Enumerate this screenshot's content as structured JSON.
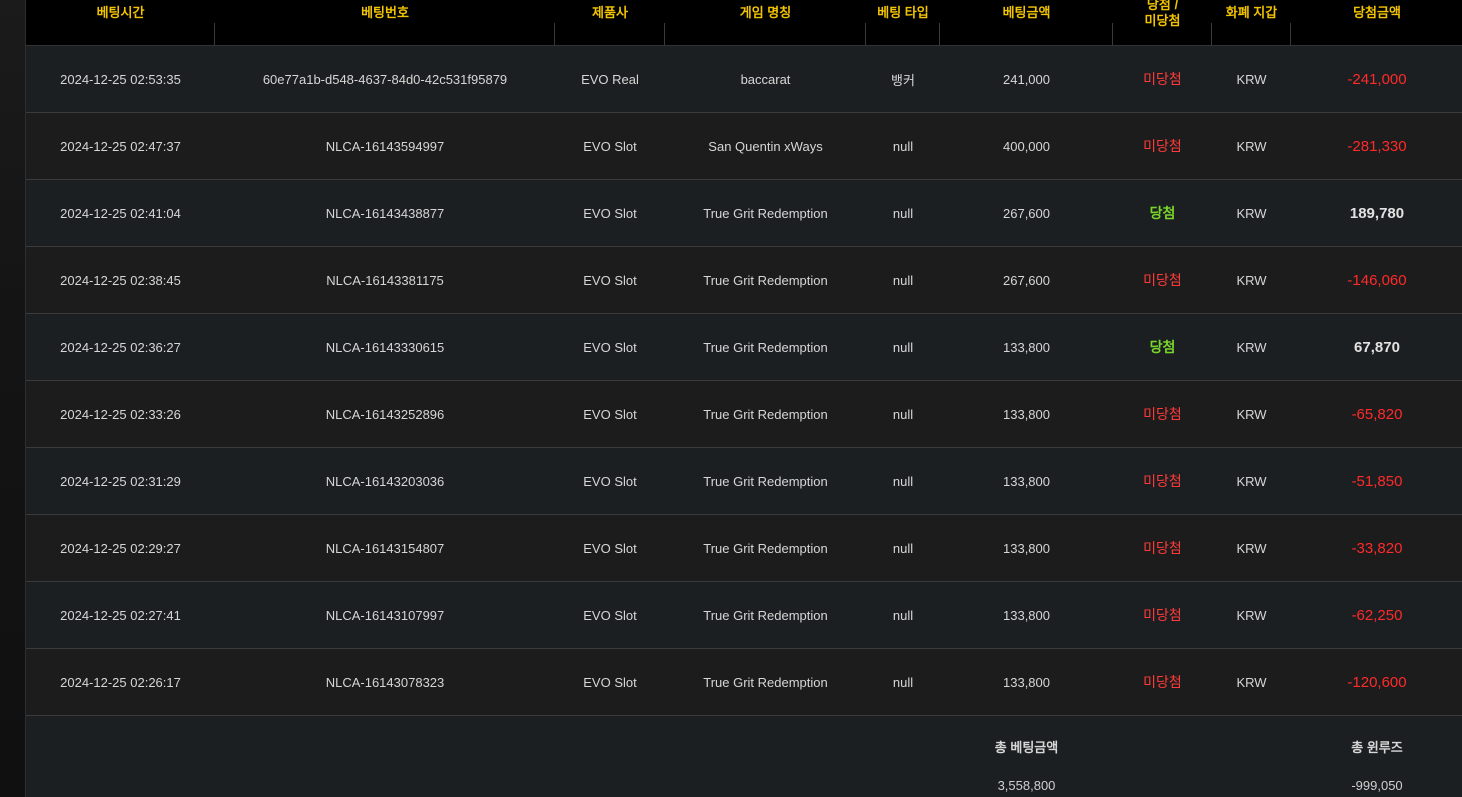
{
  "headers": {
    "time": "베팅시간",
    "bet_id": "베팅번호",
    "provider": "제품사",
    "game": "게임 명칭",
    "bet_type": "베팅 타입",
    "amount": "베팅금액",
    "result_line1": "당첨 /",
    "result_line2": "미당첨",
    "currency": "화폐 지갑",
    "payout": "당첨금액"
  },
  "rows": [
    {
      "time": "2024-12-25 02:53:35",
      "bet_id": "60e77a1b-d548-4637-84d0-42c531f95879",
      "provider": "EVO Real",
      "game": "baccarat",
      "bet_type": "뱅커",
      "amount": "241,000",
      "result": "미당첨",
      "currency": "KRW",
      "payout": "-241,000"
    },
    {
      "time": "2024-12-25 02:47:37",
      "bet_id": "NLCA-16143594997",
      "provider": "EVO Slot",
      "game": "San Quentin xWays",
      "bet_type": "null",
      "amount": "400,000",
      "result": "미당첨",
      "currency": "KRW",
      "payout": "-281,330"
    },
    {
      "time": "2024-12-25 02:41:04",
      "bet_id": "NLCA-16143438877",
      "provider": "EVO Slot",
      "game": "True Grit Redemption",
      "bet_type": "null",
      "amount": "267,600",
      "result": "당첨",
      "currency": "KRW",
      "payout": "189,780"
    },
    {
      "time": "2024-12-25 02:38:45",
      "bet_id": "NLCA-16143381175",
      "provider": "EVO Slot",
      "game": "True Grit Redemption",
      "bet_type": "null",
      "amount": "267,600",
      "result": "미당첨",
      "currency": "KRW",
      "payout": "-146,060"
    },
    {
      "time": "2024-12-25 02:36:27",
      "bet_id": "NLCA-16143330615",
      "provider": "EVO Slot",
      "game": "True Grit Redemption",
      "bet_type": "null",
      "amount": "133,800",
      "result": "당첨",
      "currency": "KRW",
      "payout": "67,870"
    },
    {
      "time": "2024-12-25 02:33:26",
      "bet_id": "NLCA-16143252896",
      "provider": "EVO Slot",
      "game": "True Grit Redemption",
      "bet_type": "null",
      "amount": "133,800",
      "result": "미당첨",
      "currency": "KRW",
      "payout": "-65,820"
    },
    {
      "time": "2024-12-25 02:31:29",
      "bet_id": "NLCA-16143203036",
      "provider": "EVO Slot",
      "game": "True Grit Redemption",
      "bet_type": "null",
      "amount": "133,800",
      "result": "미당첨",
      "currency": "KRW",
      "payout": "-51,850"
    },
    {
      "time": "2024-12-25 02:29:27",
      "bet_id": "NLCA-16143154807",
      "provider": "EVO Slot",
      "game": "True Grit Redemption",
      "bet_type": "null",
      "amount": "133,800",
      "result": "미당첨",
      "currency": "KRW",
      "payout": "-33,820"
    },
    {
      "time": "2024-12-25 02:27:41",
      "bet_id": "NLCA-16143107997",
      "provider": "EVO Slot",
      "game": "True Grit Redemption",
      "bet_type": "null",
      "amount": "133,800",
      "result": "미당첨",
      "currency": "KRW",
      "payout": "-62,250"
    },
    {
      "time": "2024-12-25 02:26:17",
      "bet_id": "NLCA-16143078323",
      "provider": "EVO Slot",
      "game": "True Grit Redemption",
      "bet_type": "null",
      "amount": "133,800",
      "result": "미당첨",
      "currency": "KRW",
      "payout": "-120,600"
    }
  ],
  "summary": {
    "total_bet_label": "총 베팅금액",
    "total_bet_value": "3,558,800",
    "total_winloss_label": "총 윈루즈",
    "total_winloss_value": "-999,050"
  },
  "colors": {
    "header_text": "#f2c300",
    "lose": "#ff3b3b",
    "win": "#7bd62a",
    "negative_amount": "#ff2a2a"
  }
}
